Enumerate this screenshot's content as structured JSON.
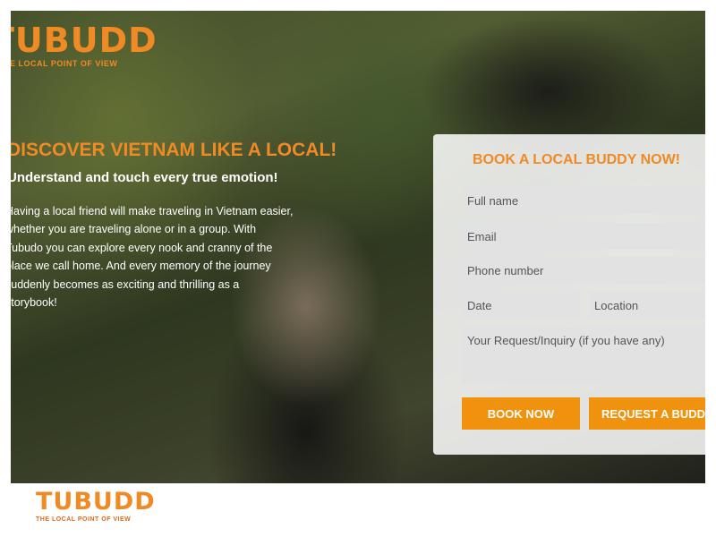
{
  "brand": {
    "logo_text": "TUBUDD",
    "tagline": "THE LOCAL POINT OF VIEW",
    "accent": "#f08a25"
  },
  "hero": {
    "headline": "DISCOVER VIETNAM LIKE A LOCAL!",
    "subheadline": "Understand and touch every true emotion!",
    "intro": "Having a local friend will make traveling in Vietnam easier, whether you are traveling alone or in a group. With Tubudo you can explore every nook and cranny of the place we call home. And every memory of the journey suddenly becomes as exciting and thrilling as a storybook!"
  },
  "form": {
    "title": "BOOK A LOCAL BUDDY NOW!",
    "full_name_placeholder": "Full name",
    "email_placeholder": "Email",
    "phone_placeholder": "Phone number",
    "date_placeholder": "Date",
    "location_placeholder": "Location",
    "request_placeholder": "Your Request/Inquiry (if you have any)",
    "book_label": "BOOK NOW",
    "request_label": "REQUEST A BUDDY",
    "button_color": "#f0920d"
  },
  "footer": {
    "logo_text": "TUBUDD",
    "tagline": "THE LOCAL POINT OF VIEW"
  }
}
